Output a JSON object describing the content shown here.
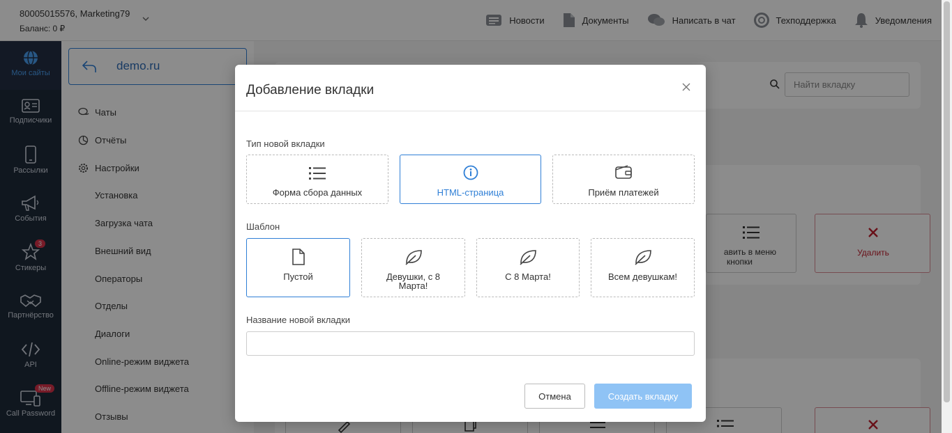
{
  "header": {
    "account_phone": "80005015576",
    "account_name": ", Marketing79",
    "balance": "Баланс: 0 ₽",
    "nav": [
      {
        "label": "Новости",
        "icon": "news-icon"
      },
      {
        "label": "Документы",
        "icon": "document-icon"
      },
      {
        "label": "Написать в чат",
        "icon": "chat-icon"
      },
      {
        "label": "Техподдержка",
        "icon": "support-icon"
      },
      {
        "label": "Уведомления",
        "icon": "bell-icon"
      }
    ]
  },
  "sidebar": {
    "items": [
      {
        "label": "Мои сайты",
        "icon": "globe-icon",
        "active": true
      },
      {
        "label": "Подписчики",
        "icon": "id-card-icon"
      },
      {
        "label": "Рассылки",
        "icon": "phone-icon"
      },
      {
        "label": "События",
        "icon": "megaphone-icon"
      },
      {
        "label": "Стикеры",
        "icon": "star-icon",
        "badge": "3"
      },
      {
        "label": "Партнёрство",
        "icon": "handshake-icon"
      },
      {
        "label": "API",
        "icon": "code-icon"
      },
      {
        "label": "Call Password",
        "icon": "monitor-phone-icon",
        "badge": "New"
      }
    ]
  },
  "site_menu": {
    "site": "demo.ru",
    "items": [
      "Чаты",
      "Отчёты",
      "Настройки"
    ],
    "sub_items": [
      "Установка",
      "Загрузка чата",
      "Внешний вид",
      "Операторы",
      "Отделы",
      "Диалоги",
      "Online-режим виджета",
      "Offline-режим виджета",
      "Отзывы"
    ]
  },
  "background": {
    "search_placeholder": "Найти вкладку",
    "btn_menu_l1": "авить в меню",
    "btn_menu_l2": "кнопки",
    "btn_delete": "Удалить"
  },
  "modal": {
    "title": "Добавление вкладки",
    "type_label": "Тип новой вкладки",
    "types": [
      {
        "label": "Форма сбора данных",
        "icon": "list-icon"
      },
      {
        "label": "HTML-страница",
        "icon": "info-icon",
        "selected": true
      },
      {
        "label": "Приём платежей",
        "icon": "wallet-icon"
      }
    ],
    "template_label": "Шаблон",
    "templates": [
      {
        "label": "Пустой",
        "icon": "blank-file-icon",
        "selected": true
      },
      {
        "label": "Девушки, с 8 Марта!",
        "icon": "leaf-icon"
      },
      {
        "label": "С 8 Марта!",
        "icon": "leaf-icon"
      },
      {
        "label": "Всем девушкам!",
        "icon": "leaf-icon"
      }
    ],
    "name_label": "Название новой вкладки",
    "name_value": "",
    "cancel": "Отмена",
    "create": "Создать вкладку"
  }
}
